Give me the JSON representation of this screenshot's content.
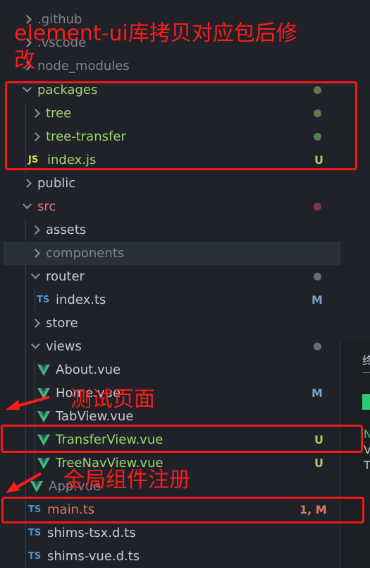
{
  "explorer": {
    "items": [
      {
        "label": ".github",
        "kind": "folder",
        "open": false
      },
      {
        "label": ".vscode",
        "kind": "folder",
        "open": false
      },
      {
        "label": "node_modules",
        "kind": "folder",
        "open": false
      },
      {
        "label": "packages",
        "kind": "folder",
        "open": true
      },
      {
        "label": "tree",
        "kind": "folder",
        "open": false
      },
      {
        "label": "tree-transfer",
        "kind": "folder",
        "open": false
      },
      {
        "label": "index.js",
        "kind": "js-file",
        "icon": "JS",
        "status": "U"
      },
      {
        "label": "public",
        "kind": "folder",
        "open": false
      },
      {
        "label": "src",
        "kind": "folder",
        "open": true
      },
      {
        "label": "assets",
        "kind": "folder",
        "open": false
      },
      {
        "label": "components",
        "kind": "folder",
        "open": false
      },
      {
        "label": "router",
        "kind": "folder",
        "open": true
      },
      {
        "label": "index.ts",
        "kind": "ts-file",
        "icon": "TS",
        "status": "M"
      },
      {
        "label": "store",
        "kind": "folder",
        "open": false
      },
      {
        "label": "views",
        "kind": "folder",
        "open": true
      },
      {
        "label": "About.vue",
        "kind": "vue-file"
      },
      {
        "label": "Home.vue",
        "kind": "vue-file",
        "status": "M"
      },
      {
        "label": "TabView.vue",
        "kind": "vue-file"
      },
      {
        "label": "TransferView.vue",
        "kind": "vue-file",
        "status": "U"
      },
      {
        "label": "TreeNavView.vue",
        "kind": "vue-file",
        "status": "U"
      },
      {
        "label": "App.vue",
        "kind": "vue-file"
      },
      {
        "label": "main.ts",
        "kind": "ts-file",
        "icon": "TS",
        "status": "1, M"
      },
      {
        "label": "shims-tsx.d.ts",
        "kind": "ts-file",
        "icon": "TS"
      },
      {
        "label": "shims-vue.d.ts",
        "kind": "ts-file",
        "icon": "TS"
      }
    ]
  },
  "annotations": {
    "copy_note_line1": "element-ui库拷贝对应包后修",
    "copy_note_line2": "改",
    "test_page": "测试页面",
    "global_register": "全局组件注册"
  },
  "side_panel": {
    "text1": "终",
    "text2": "N",
    "text3": "V",
    "text4": "T"
  },
  "colors": {
    "annotation_red": "#f21818",
    "untracked_green": "#a6c96a",
    "modified_blue": "#7d9fc5",
    "error_red": "#e8736c"
  }
}
